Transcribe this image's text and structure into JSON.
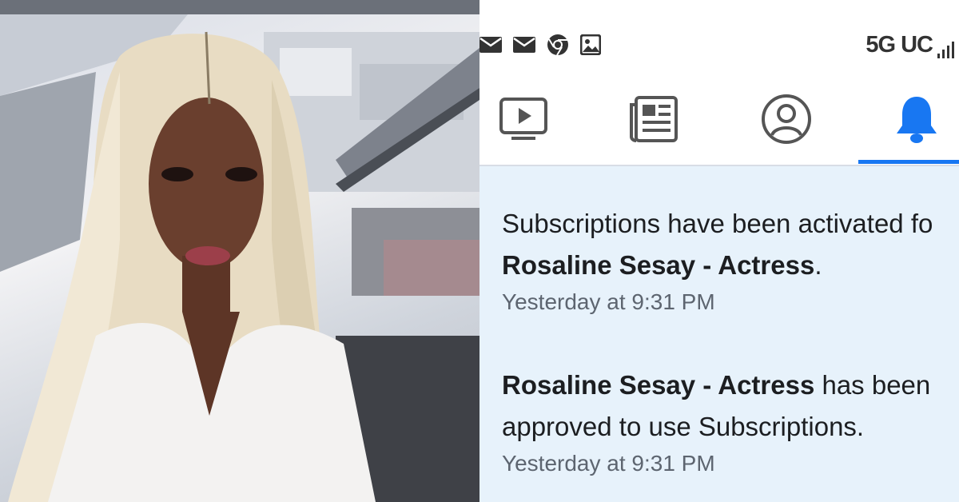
{
  "photo": {
    "description_icon": "portrait-photo"
  },
  "status_bar": {
    "icons": [
      "mail-icon",
      "mail-icon",
      "chrome-icon",
      "image-icon"
    ],
    "network": "5G UC"
  },
  "tabs": [
    {
      "icon": "video-icon",
      "active": false
    },
    {
      "icon": "news-icon",
      "active": false
    },
    {
      "icon": "profile-icon",
      "active": false
    },
    {
      "icon": "bell-icon",
      "active": true
    }
  ],
  "notifications": [
    {
      "text_prefix": "Subscriptions have been activated fo",
      "name": "Rosaline Sesay - Actress",
      "suffix": ".",
      "time": "Yesterday at 9:31 PM"
    },
    {
      "name": "Rosaline Sesay - Actress",
      "text_after_name": " has been",
      "line2": "approved to use Subscriptions.",
      "time": "Yesterday at 9:31 PM"
    }
  ],
  "colors": {
    "accent": "#1877f2",
    "notif_bg": "#e7f2fb",
    "text": "#1c1e21",
    "muted": "#5d6570"
  }
}
